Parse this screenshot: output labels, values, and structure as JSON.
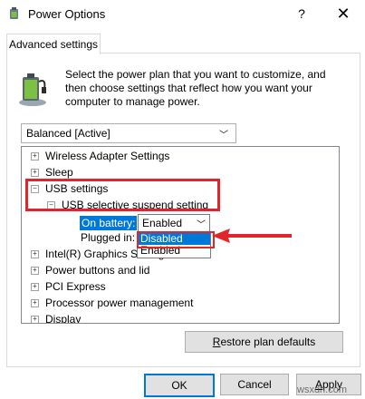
{
  "window": {
    "title": "Power Options",
    "help": "?",
    "close": "✕"
  },
  "tab": {
    "label": "Advanced settings"
  },
  "description": "Select the power plan that you want to customize, and then choose settings that reflect how you want your computer to manage power.",
  "plan_select": {
    "value": "Balanced [Active]"
  },
  "tree": {
    "items": [
      {
        "label": "Wireless Adapter Settings",
        "expander": "+"
      },
      {
        "label": "Sleep",
        "expander": "+"
      },
      {
        "label": "USB settings",
        "expander": "−"
      },
      {
        "label": "USB selective suspend setting",
        "expander": "−"
      },
      {
        "label": "On battery:"
      },
      {
        "label": "Plugged in:"
      },
      {
        "label": "Intel(R) Graphics Settings",
        "expander": "+"
      },
      {
        "label": "Power buttons and lid",
        "expander": "+"
      },
      {
        "label": "PCI Express",
        "expander": "+"
      },
      {
        "label": "Processor power management",
        "expander": "+"
      },
      {
        "label": "Display",
        "expander": "+"
      }
    ]
  },
  "on_battery_select": {
    "value": "Enabled",
    "options": [
      "Disabled",
      "Enabled"
    ],
    "highlighted": "Disabled"
  },
  "buttons": {
    "restore_prefix": "",
    "restore_underline": "R",
    "restore_rest": "estore plan defaults",
    "ok": "OK",
    "cancel": "Cancel",
    "apply_underline": "A",
    "apply_rest": "pply"
  },
  "watermark": "wsxdn.com",
  "colors": {
    "accent": "#0078d7",
    "highlight_red": "#e0262b"
  }
}
